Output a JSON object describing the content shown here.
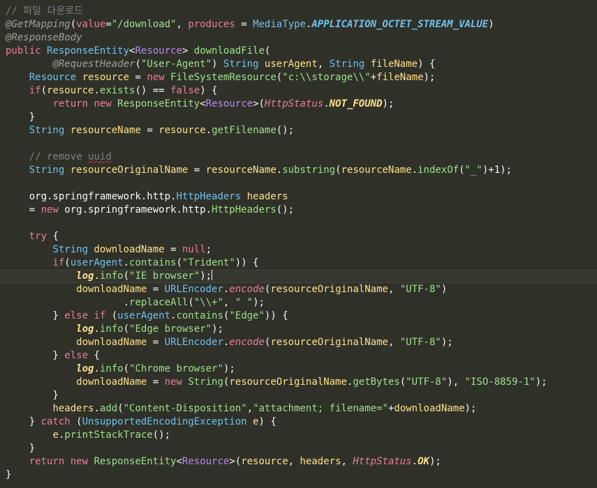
{
  "editor": {
    "language": "java",
    "caret_line": 21,
    "lines": [
      [
        {
          "t": "// 파일 다운로드",
          "c": "c-comment"
        }
      ],
      [
        {
          "t": "@GetMapping",
          "c": "c-ann"
        },
        {
          "t": "(",
          "c": "c-punct"
        },
        {
          "t": "value",
          "c": "c-kw"
        },
        {
          "t": "=",
          "c": "c-punct"
        },
        {
          "t": "\"/download\"",
          "c": "c-str"
        },
        {
          "t": ", ",
          "c": "c-punct"
        },
        {
          "t": "produces",
          "c": "c-kw"
        },
        {
          "t": " = ",
          "c": "c-punct"
        },
        {
          "t": "MediaType",
          "c": "c-type"
        },
        {
          "t": ".",
          "c": "c-punct"
        },
        {
          "t": "APPLICATION_OCTET_STREAM_VALUE",
          "c": "c-const"
        },
        {
          "t": ")",
          "c": "c-punct"
        }
      ],
      [
        {
          "t": "@ResponseBody",
          "c": "c-ann"
        }
      ],
      [
        {
          "t": "public ",
          "c": "c-kw"
        },
        {
          "t": "ResponseEntity",
          "c": "c-type"
        },
        {
          "t": "<",
          "c": "c-punct"
        },
        {
          "t": "Resource",
          "c": "c-type-ref"
        },
        {
          "t": "> ",
          "c": "c-punct"
        },
        {
          "t": "downloadFile",
          "c": "c-method"
        },
        {
          "t": "(",
          "c": "c-punct"
        }
      ],
      [
        {
          "t": "        ",
          "c": "c-plain"
        },
        {
          "t": "@RequestHeader",
          "c": "c-ann"
        },
        {
          "t": "(",
          "c": "c-punct"
        },
        {
          "t": "\"User-Agent\"",
          "c": "c-str"
        },
        {
          "t": ") ",
          "c": "c-punct"
        },
        {
          "t": "String ",
          "c": "c-type"
        },
        {
          "t": "userAgent",
          "c": "c-ident"
        },
        {
          "t": ", ",
          "c": "c-punct"
        },
        {
          "t": "String ",
          "c": "c-type"
        },
        {
          "t": "fileName",
          "c": "c-ident"
        },
        {
          "t": ") {",
          "c": "c-punct"
        }
      ],
      [
        {
          "t": "    ",
          "c": "c-plain"
        },
        {
          "t": "Resource ",
          "c": "c-type"
        },
        {
          "t": "resource",
          "c": "c-ident"
        },
        {
          "t": " = ",
          "c": "c-punct"
        },
        {
          "t": "new ",
          "c": "c-kw"
        },
        {
          "t": "FileSystemResource",
          "c": "c-method"
        },
        {
          "t": "(",
          "c": "c-punct"
        },
        {
          "t": "\"c:\\\\storage\\\\\"",
          "c": "c-str"
        },
        {
          "t": "+",
          "c": "c-punct"
        },
        {
          "t": "fileName",
          "c": "c-ident"
        },
        {
          "t": ");",
          "c": "c-punct"
        }
      ],
      [
        {
          "t": "    ",
          "c": "c-plain"
        },
        {
          "t": "if",
          "c": "c-kw"
        },
        {
          "t": "(",
          "c": "c-punct"
        },
        {
          "t": "resource",
          "c": "c-ident"
        },
        {
          "t": ".",
          "c": "c-punct"
        },
        {
          "t": "exists",
          "c": "c-method"
        },
        {
          "t": "() == ",
          "c": "c-punct"
        },
        {
          "t": "false",
          "c": "c-bool"
        },
        {
          "t": ") {",
          "c": "c-punct"
        }
      ],
      [
        {
          "t": "        ",
          "c": "c-plain"
        },
        {
          "t": "return ",
          "c": "c-kw"
        },
        {
          "t": "new ",
          "c": "c-kw"
        },
        {
          "t": "ResponseEntity",
          "c": "c-method"
        },
        {
          "t": "<",
          "c": "c-punct"
        },
        {
          "t": "Resource",
          "c": "c-type-ref"
        },
        {
          "t": ">(",
          "c": "c-punct"
        },
        {
          "t": "HttpStatus",
          "c": "c-classit"
        },
        {
          "t": ".",
          "c": "c-punct"
        },
        {
          "t": "NOT_FOUND",
          "c": "c-static"
        },
        {
          "t": ");",
          "c": "c-punct"
        }
      ],
      [
        {
          "t": "    }",
          "c": "c-punct"
        }
      ],
      [
        {
          "t": "    ",
          "c": "c-plain"
        },
        {
          "t": "String ",
          "c": "c-type"
        },
        {
          "t": "resourceName",
          "c": "c-ident"
        },
        {
          "t": " = ",
          "c": "c-punct"
        },
        {
          "t": "resource",
          "c": "c-ident"
        },
        {
          "t": ".",
          "c": "c-punct"
        },
        {
          "t": "getFilename",
          "c": "c-method"
        },
        {
          "t": "();",
          "c": "c-punct"
        }
      ],
      [],
      [
        {
          "t": "    ",
          "c": "c-plain"
        },
        {
          "t": "// remove ",
          "c": "c-comment"
        },
        {
          "t": "uuid",
          "c": "c-comment squiggle"
        }
      ],
      [
        {
          "t": "    ",
          "c": "c-plain"
        },
        {
          "t": "String ",
          "c": "c-type"
        },
        {
          "t": "resourceOriginalName",
          "c": "c-ident"
        },
        {
          "t": " = ",
          "c": "c-punct"
        },
        {
          "t": "resourceName",
          "c": "c-ident"
        },
        {
          "t": ".",
          "c": "c-punct"
        },
        {
          "t": "substring",
          "c": "c-method"
        },
        {
          "t": "(",
          "c": "c-punct"
        },
        {
          "t": "resourceName",
          "c": "c-ident"
        },
        {
          "t": ".",
          "c": "c-punct"
        },
        {
          "t": "indexOf",
          "c": "c-method"
        },
        {
          "t": "(",
          "c": "c-punct"
        },
        {
          "t": "\"_\"",
          "c": "c-str"
        },
        {
          "t": ")+",
          "c": "c-punct"
        },
        {
          "t": "1",
          "c": "c-num"
        },
        {
          "t": ");",
          "c": "c-punct"
        }
      ],
      [],
      [
        {
          "t": "    org.springframework.http.",
          "c": "c-plain"
        },
        {
          "t": "HttpHeaders ",
          "c": "c-type"
        },
        {
          "t": "headers",
          "c": "c-ident"
        }
      ],
      [
        {
          "t": "    = ",
          "c": "c-punct"
        },
        {
          "t": "new ",
          "c": "c-kw"
        },
        {
          "t": "org.springframework.http.",
          "c": "c-plain"
        },
        {
          "t": "HttpHeaders",
          "c": "c-method"
        },
        {
          "t": "();",
          "c": "c-punct"
        }
      ],
      [],
      [
        {
          "t": "    ",
          "c": "c-plain"
        },
        {
          "t": "try",
          "c": "c-kw"
        },
        {
          "t": " {",
          "c": "c-punct"
        }
      ],
      [
        {
          "t": "        ",
          "c": "c-plain"
        },
        {
          "t": "String ",
          "c": "c-type"
        },
        {
          "t": "downloadName",
          "c": "c-ident"
        },
        {
          "t": " = ",
          "c": "c-punct"
        },
        {
          "t": "null",
          "c": "c-bool"
        },
        {
          "t": ";",
          "c": "c-punct"
        }
      ],
      [
        {
          "t": "        ",
          "c": "c-plain"
        },
        {
          "t": "if",
          "c": "c-kw"
        },
        {
          "t": "(",
          "c": "c-punct"
        },
        {
          "t": "userAgent",
          "c": "c-type"
        },
        {
          "t": ".",
          "c": "c-punct"
        },
        {
          "t": "contains",
          "c": "c-method"
        },
        {
          "t": "(",
          "c": "c-punct"
        },
        {
          "t": "\"Trident\"",
          "c": "c-str"
        },
        {
          "t": ")) {",
          "c": "c-punct"
        }
      ],
      [
        {
          "t": "            ",
          "c": "c-plain"
        },
        {
          "t": "log",
          "c": "c-static"
        },
        {
          "t": ".",
          "c": "c-punct"
        },
        {
          "t": "info",
          "c": "c-method"
        },
        {
          "t": "(",
          "c": "c-punct"
        },
        {
          "t": "\"IE browser\"",
          "c": "c-str"
        },
        {
          "t": ");",
          "c": "c-punct"
        },
        {
          "t": "",
          "c": "caret"
        }
      ],
      [
        {
          "t": "            ",
          "c": "c-plain"
        },
        {
          "t": "downloadName",
          "c": "c-ident"
        },
        {
          "t": " = ",
          "c": "c-punct"
        },
        {
          "t": "URLEncoder",
          "c": "c-type"
        },
        {
          "t": ".",
          "c": "c-punct"
        },
        {
          "t": "encode",
          "c": "c-classit"
        },
        {
          "t": "(",
          "c": "c-punct"
        },
        {
          "t": "resourceOriginalName",
          "c": "c-ident"
        },
        {
          "t": ", ",
          "c": "c-punct"
        },
        {
          "t": "\"UTF-8\"",
          "c": "c-str"
        },
        {
          "t": ")",
          "c": "c-punct"
        }
      ],
      [
        {
          "t": "                    .",
          "c": "c-punct"
        },
        {
          "t": "replaceAll",
          "c": "c-method"
        },
        {
          "t": "(",
          "c": "c-punct"
        },
        {
          "t": "\"\\\\+\"",
          "c": "c-str"
        },
        {
          "t": ", ",
          "c": "c-punct"
        },
        {
          "t": "\" \"",
          "c": "c-str"
        },
        {
          "t": ");",
          "c": "c-punct"
        }
      ],
      [
        {
          "t": "        } ",
          "c": "c-punct"
        },
        {
          "t": "else if ",
          "c": "c-kw"
        },
        {
          "t": "(",
          "c": "c-punct"
        },
        {
          "t": "userAgent",
          "c": "c-type"
        },
        {
          "t": ".",
          "c": "c-punct"
        },
        {
          "t": "contains",
          "c": "c-method"
        },
        {
          "t": "(",
          "c": "c-punct"
        },
        {
          "t": "\"Edge\"",
          "c": "c-str"
        },
        {
          "t": ")) {",
          "c": "c-punct"
        }
      ],
      [
        {
          "t": "            ",
          "c": "c-plain"
        },
        {
          "t": "log",
          "c": "c-static"
        },
        {
          "t": ".",
          "c": "c-punct"
        },
        {
          "t": "info",
          "c": "c-method"
        },
        {
          "t": "(",
          "c": "c-punct"
        },
        {
          "t": "\"Edge browser\"",
          "c": "c-str"
        },
        {
          "t": ");",
          "c": "c-punct"
        }
      ],
      [
        {
          "t": "            ",
          "c": "c-plain"
        },
        {
          "t": "downloadName",
          "c": "c-ident"
        },
        {
          "t": " = ",
          "c": "c-punct"
        },
        {
          "t": "URLEncoder",
          "c": "c-type"
        },
        {
          "t": ".",
          "c": "c-punct"
        },
        {
          "t": "encode",
          "c": "c-classit"
        },
        {
          "t": "(",
          "c": "c-punct"
        },
        {
          "t": "resourceOriginalName",
          "c": "c-ident"
        },
        {
          "t": ", ",
          "c": "c-punct"
        },
        {
          "t": "\"UTF-8\"",
          "c": "c-str"
        },
        {
          "t": ");",
          "c": "c-punct"
        }
      ],
      [
        {
          "t": "        } ",
          "c": "c-punct"
        },
        {
          "t": "else",
          "c": "c-kw"
        },
        {
          "t": " {",
          "c": "c-punct"
        }
      ],
      [
        {
          "t": "            ",
          "c": "c-plain"
        },
        {
          "t": "log",
          "c": "c-static"
        },
        {
          "t": ".",
          "c": "c-punct"
        },
        {
          "t": "info",
          "c": "c-method"
        },
        {
          "t": "(",
          "c": "c-punct"
        },
        {
          "t": "\"Chrome browser\"",
          "c": "c-str"
        },
        {
          "t": ");",
          "c": "c-punct"
        }
      ],
      [
        {
          "t": "            ",
          "c": "c-plain"
        },
        {
          "t": "downloadName",
          "c": "c-ident"
        },
        {
          "t": " = ",
          "c": "c-punct"
        },
        {
          "t": "new ",
          "c": "c-kw"
        },
        {
          "t": "String",
          "c": "c-method"
        },
        {
          "t": "(",
          "c": "c-punct"
        },
        {
          "t": "resourceOriginalName",
          "c": "c-ident"
        },
        {
          "t": ".",
          "c": "c-punct"
        },
        {
          "t": "getBytes",
          "c": "c-method"
        },
        {
          "t": "(",
          "c": "c-punct"
        },
        {
          "t": "\"UTF-8\"",
          "c": "c-str"
        },
        {
          "t": "), ",
          "c": "c-punct"
        },
        {
          "t": "\"ISO-8859-1\"",
          "c": "c-str"
        },
        {
          "t": ");",
          "c": "c-punct"
        }
      ],
      [
        {
          "t": "        }",
          "c": "c-punct"
        }
      ],
      [
        {
          "t": "        ",
          "c": "c-plain"
        },
        {
          "t": "headers",
          "c": "c-ident"
        },
        {
          "t": ".",
          "c": "c-punct"
        },
        {
          "t": "add",
          "c": "c-method"
        },
        {
          "t": "(",
          "c": "c-punct"
        },
        {
          "t": "\"Content-Disposition\"",
          "c": "c-str"
        },
        {
          "t": ",",
          "c": "c-punct"
        },
        {
          "t": "\"attachment; filename=\"",
          "c": "c-str"
        },
        {
          "t": "+",
          "c": "c-punct"
        },
        {
          "t": "downloadName",
          "c": "c-ident"
        },
        {
          "t": ");",
          "c": "c-punct"
        }
      ],
      [
        {
          "t": "    } ",
          "c": "c-punct"
        },
        {
          "t": "catch ",
          "c": "c-kw"
        },
        {
          "t": "(",
          "c": "c-punct"
        },
        {
          "t": "UnsupportedEncodingException ",
          "c": "c-type"
        },
        {
          "t": "e",
          "c": "c-ident"
        },
        {
          "t": ") {",
          "c": "c-punct"
        }
      ],
      [
        {
          "t": "        ",
          "c": "c-plain"
        },
        {
          "t": "e",
          "c": "c-ident"
        },
        {
          "t": ".",
          "c": "c-punct"
        },
        {
          "t": "printStackTrace",
          "c": "c-method"
        },
        {
          "t": "();",
          "c": "c-punct"
        }
      ],
      [
        {
          "t": "    }",
          "c": "c-punct"
        }
      ],
      [
        {
          "t": "    ",
          "c": "c-plain"
        },
        {
          "t": "return ",
          "c": "c-kw"
        },
        {
          "t": "new ",
          "c": "c-kw"
        },
        {
          "t": "ResponseEntity",
          "c": "c-method"
        },
        {
          "t": "<",
          "c": "c-punct"
        },
        {
          "t": "Resource",
          "c": "c-type-ref"
        },
        {
          "t": ">(",
          "c": "c-punct"
        },
        {
          "t": "resource",
          "c": "c-ident"
        },
        {
          "t": ", ",
          "c": "c-punct"
        },
        {
          "t": "headers",
          "c": "c-ident"
        },
        {
          "t": ", ",
          "c": "c-punct"
        },
        {
          "t": "HttpStatus",
          "c": "c-classit"
        },
        {
          "t": ".",
          "c": "c-punct"
        },
        {
          "t": "OK",
          "c": "c-static"
        },
        {
          "t": ");",
          "c": "c-punct"
        }
      ],
      [
        {
          "t": "}",
          "c": "c-punct"
        }
      ]
    ]
  }
}
